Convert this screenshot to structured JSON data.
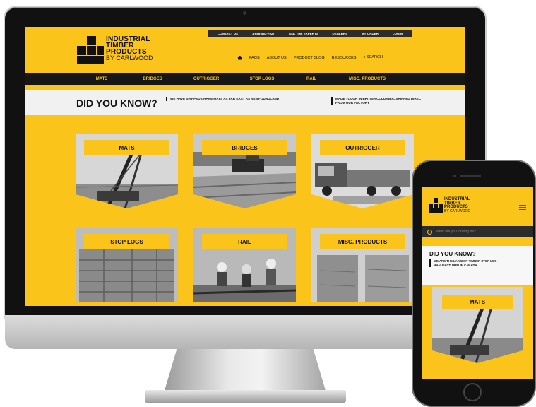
{
  "desktop": {
    "topbar": [
      "CONTACT US",
      "1-888-463-7927",
      "ASK THE EXPERTS",
      "DEALERS",
      "MY ORDER",
      "LOGIN"
    ],
    "logo": {
      "line1": "INDUSTRIAL",
      "line2": "TIMBER",
      "line3": "PRODUCTS",
      "line4": "BY CARLWOOD"
    },
    "mainnav": [
      "FAQS",
      "ABOUT US",
      "PRODUCT BLOG",
      "RESOURCES",
      "SEARCH"
    ],
    "categories": [
      "MATS",
      "BRIDGES",
      "OUTRIGGER",
      "STOP LOGS",
      "RAIL",
      "MISC. PRODUCTS"
    ],
    "did_you_know": {
      "title": "DID YOU KNOW?",
      "fact": "WE HAVE SHIPPED CRANE MATS AS FAR EAST AS NEWFOUNDLAND",
      "made": "MADE TOUGH IN BRITISH COLUMBIA, SHIPPED DIRECT FROM OUR FACTORY"
    },
    "tiles": [
      "MATS",
      "BRIDGES",
      "OUTRIGGER",
      "STOP LOGS",
      "RAIL",
      "MISC. PRODUCTS"
    ]
  },
  "mobile": {
    "logo": {
      "line1": "INDUSTRIAL",
      "line2": "TIMBER",
      "line3": "PRODUCTS",
      "line4": "BY CARLWOOD"
    },
    "search_placeholder": "What are you looking for?",
    "did_you_know": {
      "title": "DID YOU KNOW?",
      "fact": "WE ARE THE LARGEST TIMBER STOP LOG MANUFACTURER IN CANADA"
    },
    "tile": "MATS"
  },
  "colors": {
    "brand_yellow": "#fbc41a",
    "dark": "#161616"
  }
}
